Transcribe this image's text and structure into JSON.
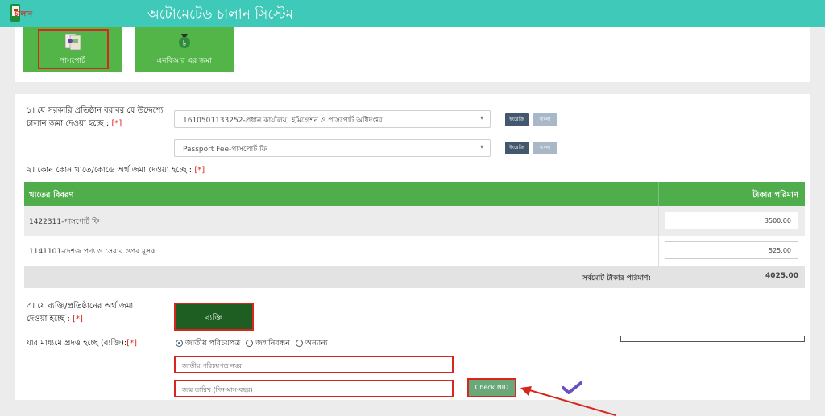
{
  "header": {
    "title": "অটোমেটেড চালান সিস্টেম",
    "logo_text": "চালান"
  },
  "tiles": [
    {
      "label": "পাসপোর্ট"
    },
    {
      "label": "এনবিআর এর জমা"
    }
  ],
  "section1": {
    "question": "১। যে সরকারি প্রতিষ্ঠান বরাবর যে উদ্দেশ্যে চালান জমা দেওয়া হচ্ছে :",
    "req": "[*]",
    "select1": "1610501133252-প্রধান কার্যালয়, ইমিগ্রেশন ও পাসপোর্ট অধিদপ্তর",
    "select2": "Passport Fee-পাসপোর্ট ফি",
    "btn_dark": "ইংরেজি",
    "btn_light": "বাংলা"
  },
  "section2": {
    "question": "২। কোন কোন খাতে/কোডে অর্থ জমা দেওয়া হচ্ছে :",
    "req": "[*]",
    "col_desc": "খাতের বিবরণ",
    "col_amount": "টাকার পরিমাণ",
    "rows": [
      {
        "desc": "1422311-পাসপোর্ট ফি",
        "amount": "3500.00"
      },
      {
        "desc": "1141101-দেশজ পণ্য ও সেবার ওপর মূসক",
        "amount": "525.00"
      }
    ],
    "total_label": "সর্বমোট টাকার পরিমাণ:",
    "total_value": "4025.00"
  },
  "section3": {
    "question": "৩। যে ব্যক্তি/প্রতিষ্ঠানের অর্থ জমা দেওয়া হচ্ছে :",
    "req": "[*]",
    "person_btn": "ব্যক্তি",
    "method_label": "যার মাধ্যমে প্রদত্ত হচ্ছে (ব্যক্তি):",
    "method_req": "[*]",
    "options": [
      "জাতীয় পরিচয়পত্র",
      "জন্মনিবন্ধন",
      "অন্যান্য"
    ],
    "selected_option": "জাতীয় পরিচয়পত্র",
    "nid_placeholder": "জাতীয় পরিচয়পত্র নম্বর",
    "dob_placeholder": "জন্ম তারিখ (দিন-মাস-বছর)",
    "check_btn": "Check NID"
  },
  "colors": {
    "header": "#3fc9b8",
    "tile": "#53b447",
    "table_head": "#4fae4b",
    "highlight": "#d7261e",
    "person_btn": "#1f5e22"
  }
}
